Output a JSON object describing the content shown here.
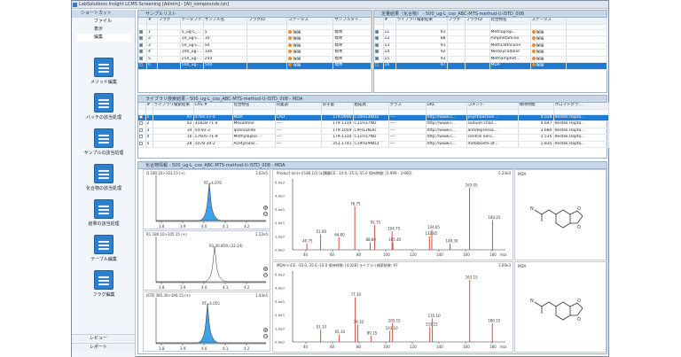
{
  "window": {
    "title": "LabSolutions Insight LCMS Screening [Admin] - [All_compounds.lsn]"
  },
  "sidebar": {
    "header": "ショートカット",
    "menu": [
      "ファイル",
      "表示",
      "編集"
    ],
    "buttons": [
      {
        "label": "メソッド編集",
        "icon": "method-edit-icon"
      },
      {
        "label": "バッチの該当処理",
        "icon": "batch-process-icon"
      },
      {
        "label": "サンプルの該当処理",
        "icon": "sample-process-icon"
      },
      {
        "label": "化合物の該当処理",
        "icon": "compound-process-icon"
      },
      {
        "label": "結果の該当処理",
        "icon": "result-process-icon"
      },
      {
        "label": "テーブル編集",
        "icon": "table-edit-icon"
      },
      {
        "label": "フラグ編集",
        "icon": "flag-edit-icon"
      }
    ],
    "bottom": [
      "レビュー",
      "レポート"
    ]
  },
  "sample_list": {
    "title": "サンプルリスト",
    "columns": [
      "#",
      "フラグ",
      "データファ...",
      "サンプル名",
      "フラグID",
      "ステータス",
      "サンプルタイ..."
    ],
    "rows": [
      {
        "num": "1",
        "file": "5_ug-L_...",
        "name": "5",
        "status": "保留",
        "type": "標準",
        "sel": false
      },
      {
        "num": "2",
        "file": "10_ug-L...",
        "name": "10",
        "status": "保留",
        "type": "標準",
        "sel": false
      },
      {
        "num": "3",
        "file": "50_ug-L...",
        "name": "50",
        "status": "保留",
        "type": "標準",
        "sel": false
      },
      {
        "num": "4",
        "file": "100_ug-...",
        "name": "100",
        "status": "保留",
        "type": "標準",
        "sel": false
      },
      {
        "num": "5",
        "file": "250_ug-...",
        "name": "250",
        "status": "保留",
        "type": "標準",
        "sel": false
      },
      {
        "num": "6",
        "file": "500_ug-...",
        "name": "500",
        "status": "保留",
        "type": "標準",
        "sel": true
      }
    ]
  },
  "quant_results": {
    "title": "定量結果（化合物） - 500_ug-L_cso_ABC-MTS-method-U-ISTD_008",
    "columns": [
      "#",
      "",
      "ライブラリ検索結果",
      "フラグ",
      "フラグID",
      "化合物名",
      "ステータス"
    ],
    "rows": [
      {
        "num": "11",
        "lib": "91",
        "name": "Methoprop...",
        "status": "保留",
        "sel": false
      },
      {
        "num": "12",
        "lib": "88",
        "name": "Amphetamine",
        "status": "保留",
        "sel": false
      },
      {
        "num": "13",
        "lib": "91",
        "name": "Methcathinone",
        "status": "保留",
        "sel": false
      },
      {
        "num": "14",
        "lib": "92",
        "name": "Noroxycodone",
        "status": "保留",
        "sel": false
      },
      {
        "num": "15",
        "lib": "93",
        "name": "Methamphet...",
        "status": "保留",
        "sel": false
      },
      {
        "num": "16",
        "lib": "97",
        "name": "MDA",
        "status": "保留",
        "sel": true
      }
    ]
  },
  "library": {
    "title": "ライブラリ検索結果 - 500_ug-L_cso_ABC-MTS-method-U-ISTD_008 - MDA",
    "columns": [
      "#",
      "ライブラリ検索結果",
      "CAS #",
      "化合物名",
      "同義語",
      "分子量",
      "組成式",
      "クラス",
      "URL",
      "コメント",
      "保持時間",
      "クロマトグラ..."
    ],
    "rows": [
      {
        "num": "1",
        "score": "97",
        "cas": "4764-17-4",
        "name": "MDA",
        "syn": "CAO",
        "mw": "179.0946",
        "formula": "C10H13NO2",
        "cls": "----",
        "url": "http://www.c...",
        "comment": "psychoactive ...",
        "rt": "4.028",
        "col": "Restek Rapto...",
        "sel": true
      },
      {
        "num": "2",
        "score": "42",
        "cas": "31828-71-4",
        "name": "Mexiletine",
        "syn": "----",
        "mw": "179.1310",
        "formula": "C11H17NO",
        "cls": "----",
        "url": "http://www.c...",
        "comment": "sodium chan...",
        "rt": "4.647",
        "col": "Restek Rapto...",
        "sel": false
      },
      {
        "num": "3",
        "score": "34",
        "cas": "54-92-2",
        "name": "Iproniazide",
        "syn": "----",
        "mw": "179.1059",
        "formula": "C9H13N3O",
        "cls": "----",
        "url": "http://www.c...",
        "comment": "antidepressa...",
        "rt": "3.680",
        "col": "Restek Rapto...",
        "sel": false
      },
      {
        "num": "4",
        "score": "10",
        "cas": "17605-71-9",
        "name": "Methylephe...",
        "syn": "----",
        "mw": "179.1310",
        "formula": "C11H17NO",
        "cls": "----",
        "url": "http://www.c...",
        "comment": "central nerv...",
        "rt": "3.515",
        "col": "Restek Rapto...",
        "sel": false
      },
      {
        "num": "5",
        "score": "28",
        "cas": "1078-30-2",
        "name": "Acetylsalic...",
        "syn": "----",
        "mw": "351.1741",
        "formula": "C19H29NO3",
        "cls": "----",
        "url": "http://www.c...",
        "comment": "metabolite of...",
        "rt": "1.835",
        "col": "Restek Rapto...",
        "sel": false
      }
    ]
  },
  "compound_info": {
    "title": "化合物情報 - 500_ug-L_cso_ABC-MTS-method-U-ISTD_008 - MDA",
    "chroms": [
      {
        "label": "Q 180.10>163.15 (+)",
        "peak": "RT=4.076",
        "ymax": "3.02e5"
      },
      {
        "label": "R1 180.10>105.15 (+)",
        "peak": "R1 30.85% (32.14)",
        "ymax": "2.22e5"
      },
      {
        "label": "ISTD 385.30>196.15 (+)",
        "peak": "RT=4.055",
        "ymax": "1.43e5"
      }
    ],
    "time_ticks": [
      "3.8",
      "3.9",
      "4.0",
      "4.1",
      "4.2"
    ],
    "time_unit": "保持時間",
    "spec_top_label": "Product Ion(+)[180.10] [a]積算CE: -10.0,-35.0,-55.0 保持時間: [3.999 - 3.900]",
    "spec_top_max": "5.24e3",
    "spec_top_peaks": [
      {
        "mz": 40.75,
        "i": 10,
        "lbl": "40.75"
      },
      {
        "mz": 51.05,
        "i": 25,
        "lbl": "51.00"
      },
      {
        "mz": 64.8,
        "i": 20,
        "lbl": "64.80"
      },
      {
        "mz": 76.75,
        "i": 70,
        "lbl": "76.75"
      },
      {
        "mz": 88.3,
        "i": 12,
        "lbl": "88.80"
      },
      {
        "mz": 91.75,
        "i": 40,
        "lbl": "91.75"
      },
      {
        "mz": 104.75,
        "i": 30,
        "lbl": "104.75"
      },
      {
        "mz": 105.4,
        "i": 12,
        "lbl": "105.40"
      },
      {
        "mz": 132.85,
        "i": 22,
        "lbl": "132.85"
      },
      {
        "mz": 134.65,
        "i": 32,
        "lbl": "134.65"
      },
      {
        "mz": 148.3,
        "i": 10,
        "lbl": "148.30"
      },
      {
        "mz": 163.05,
        "i": 100,
        "lbl": "163.05"
      },
      {
        "mz": 180.25,
        "i": 48,
        "lbl": "180.25"
      }
    ],
    "spec_bot_label": "MDA(+)CE: -50.0,-35.0,-10.0 保持時間: [4.028] ライブラリ検索結果: 97",
    "spec_bot_max": "1.00e3",
    "spec_bot_peaks": [
      {
        "mz": 51.1,
        "i": 20,
        "lbl": "51.10"
      },
      {
        "mz": 65.1,
        "i": 12,
        "lbl": "65.10"
      },
      {
        "mz": 77.1,
        "i": 72,
        "lbl": "77.10"
      },
      {
        "mz": 79.1,
        "i": 28,
        "lbl": "79.10"
      },
      {
        "mz": 89.15,
        "i": 10,
        "lbl": "89.15"
      },
      {
        "mz": 103.1,
        "i": 18,
        "lbl": "103.10"
      },
      {
        "mz": 105.15,
        "i": 30,
        "lbl": "105.15"
      },
      {
        "mz": 133.15,
        "i": 24,
        "lbl": "133.15"
      },
      {
        "mz": 135.1,
        "i": 38,
        "lbl": "135.10"
      },
      {
        "mz": 163.15,
        "i": 100,
        "lbl": "163.15"
      },
      {
        "mz": 180.15,
        "i": 30,
        "lbl": "180.15"
      }
    ],
    "mz_ticks": [
      "40",
      "60",
      "80",
      "100",
      "120",
      "140",
      "160",
      "180"
    ],
    "mz_unit": "m/z",
    "intensity_ticks": [
      "0.0e0",
      "1.0e3",
      "2.0e3",
      "3.0e3",
      "4.0e3",
      "5.0e3"
    ],
    "structure_label": "MDA"
  }
}
